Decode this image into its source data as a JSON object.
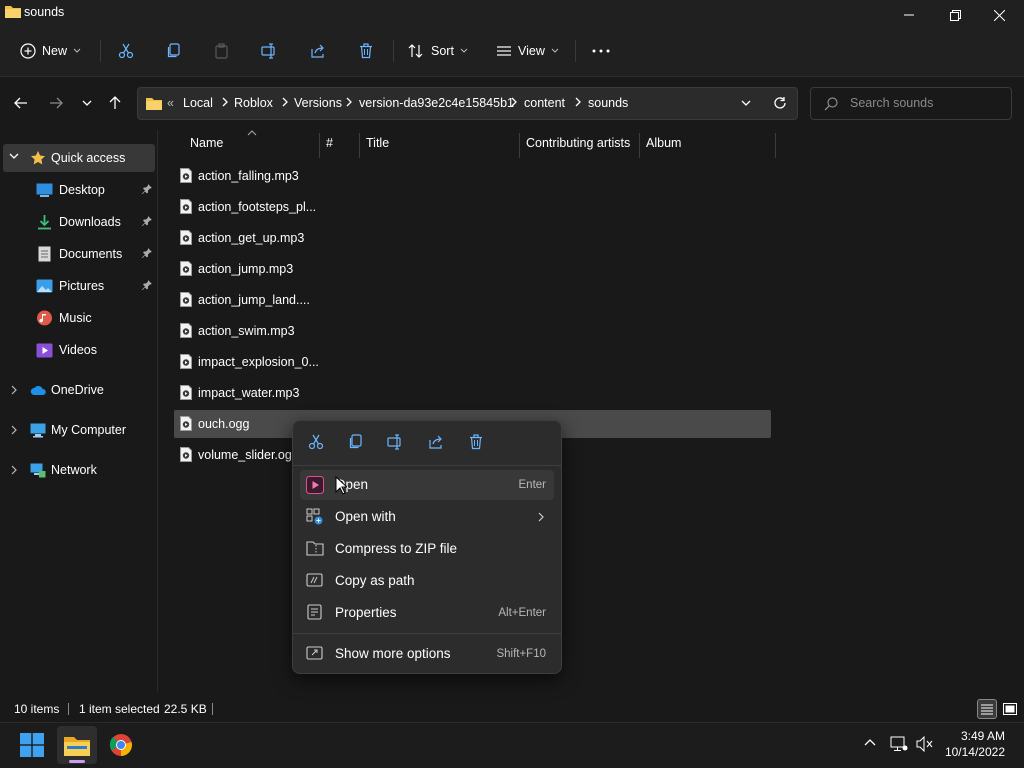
{
  "window": {
    "title": "sounds"
  },
  "toolbar": {
    "new_label": "New",
    "sort_label": "Sort",
    "view_label": "View"
  },
  "breadcrumb": [
    "Local",
    "Roblox",
    "Versions",
    "version-da93e2c4e15845b1",
    "content",
    "sounds"
  ],
  "search": {
    "placeholder": "Search sounds"
  },
  "sidebar": {
    "quick_access": "Quick access",
    "items": [
      {
        "label": "Desktop",
        "pinned": true,
        "icon": "desktop-icon"
      },
      {
        "label": "Downloads",
        "pinned": true,
        "icon": "downloads-icon"
      },
      {
        "label": "Documents",
        "pinned": true,
        "icon": "documents-icon"
      },
      {
        "label": "Pictures",
        "pinned": true,
        "icon": "pictures-icon"
      },
      {
        "label": "Music",
        "pinned": false,
        "icon": "music-icon"
      },
      {
        "label": "Videos",
        "pinned": false,
        "icon": "videos-icon"
      }
    ],
    "roots": [
      {
        "label": "OneDrive",
        "icon": "onedrive-icon"
      },
      {
        "label": "My Computer",
        "icon": "computer-icon"
      },
      {
        "label": "Network",
        "icon": "network-icon"
      }
    ]
  },
  "columns": [
    "Name",
    "#",
    "Title",
    "Contributing artists",
    "Album"
  ],
  "files": [
    "action_falling.mp3",
    "action_footsteps_pl...",
    "action_get_up.mp3",
    "action_jump.mp3",
    "action_jump_land....",
    "action_swim.mp3",
    "impact_explosion_0...",
    "impact_water.mp3",
    "ouch.ogg",
    "volume_slider.ogg"
  ],
  "selected_file_index": 8,
  "context_menu": {
    "quick_actions": [
      "cut-icon",
      "copy-icon",
      "rename-icon",
      "share-icon",
      "delete-icon"
    ],
    "items": [
      {
        "label": "Open",
        "shortcut": "Enter"
      },
      {
        "label": "Open with",
        "shortcut": ""
      },
      {
        "label": "Compress to ZIP file",
        "shortcut": ""
      },
      {
        "label": "Copy as path",
        "shortcut": ""
      },
      {
        "label": "Properties",
        "shortcut": "Alt+Enter"
      }
    ],
    "more": {
      "label": "Show more options",
      "shortcut": "Shift+F10"
    }
  },
  "status": {
    "item_count": "10 items",
    "selection": "1 item selected",
    "size": "22.5 KB"
  },
  "taskbar": {
    "time": "3:49 AM",
    "date": "10/14/2022"
  },
  "colors": {
    "accent": "#0078d4",
    "folder": "#f2c04a",
    "selection": "#4a4a4a",
    "background": "#191919"
  }
}
